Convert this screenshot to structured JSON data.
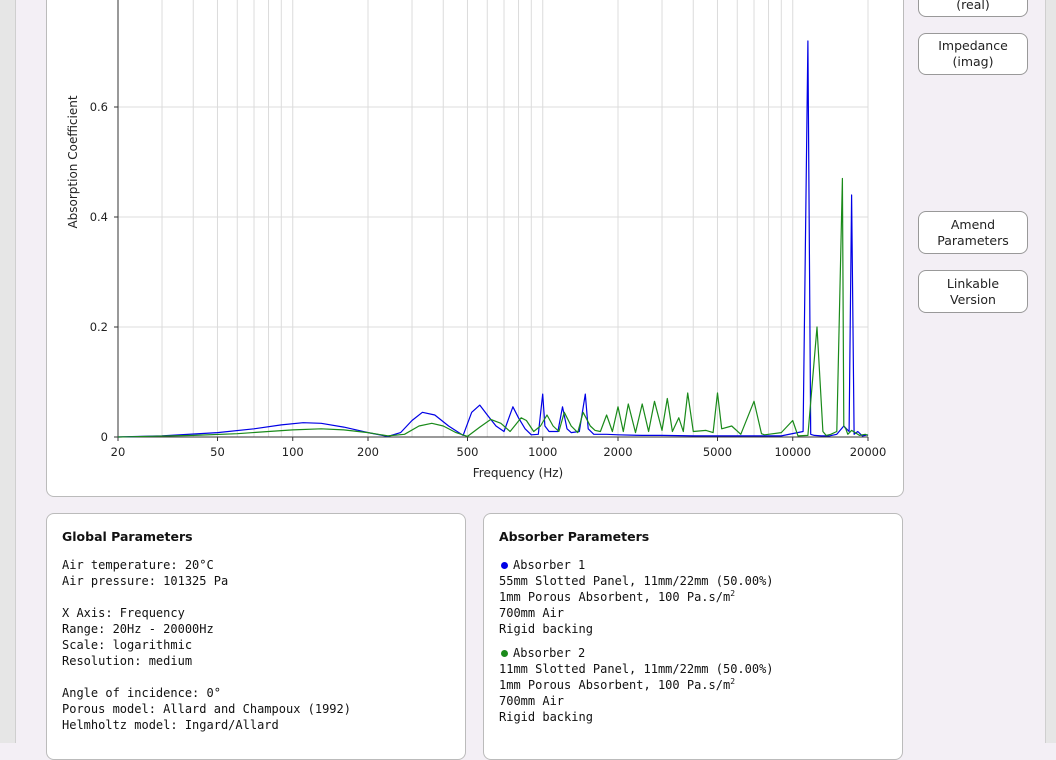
{
  "buttons": {
    "real": "(real)",
    "imag": "Impedance\n(imag)",
    "amend": "Amend\nParameters",
    "link": "Linkable\nVersion"
  },
  "global": {
    "title": "Global Parameters",
    "air_temperature": "Air temperature: 20°C",
    "air_pressure": "Air pressure: 101325 Pa",
    "x_axis": "X Axis: Frequency",
    "range": "Range: 20Hz - 20000Hz",
    "scale": "Scale: logarithmic",
    "resolution": "Resolution: medium",
    "angle": "Angle of incidence: 0°",
    "porous_model": "Porous model: Allard and Champoux (1992)",
    "helmholtz_model": "Helmholtz model: Ingard/Allard"
  },
  "absorbers": {
    "title": "Absorber Parameters",
    "items": [
      {
        "name": "Absorber 1",
        "color": "#0000e6",
        "panel": "55mm Slotted Panel, 11mm/22mm (50.00%)",
        "porous": "1mm Porous Absorbent, 100 Pa.s/m",
        "porous_sup": "2",
        "air": "700mm Air",
        "backing": "Rigid backing"
      },
      {
        "name": "Absorber 2",
        "color": "#1a8a1a",
        "panel": "11mm Slotted Panel, 11mm/22mm (50.00%)",
        "porous": "1mm Porous Absorbent, 100 Pa.s/m",
        "porous_sup": "2",
        "air": "700mm Air",
        "backing": "Rigid backing"
      }
    ]
  },
  "chart_data": {
    "type": "line",
    "xlabel": "Frequency (Hz)",
    "ylabel": "Absorption Coefficient",
    "xscale": "log",
    "xlim": [
      20,
      20000
    ],
    "ylim": [
      0,
      0.75
    ],
    "xticks": [
      20,
      50,
      100,
      200,
      500,
      1000,
      2000,
      5000,
      10000,
      20000
    ],
    "yticks": [
      0,
      0.2,
      0.4,
      0.6
    ],
    "ytick_labels": [
      "0",
      "0.2",
      "0.4",
      "0.6"
    ],
    "grid": true,
    "series": [
      {
        "color": "#0000e6",
        "x": [
          20,
          30,
          50,
          70,
          90,
          110,
          130,
          160,
          200,
          240,
          270,
          300,
          330,
          370,
          420,
          480,
          520,
          560,
          600,
          650,
          700,
          760,
          800,
          850,
          900,
          960,
          1000,
          1020,
          1060,
          1150,
          1200,
          1250,
          1300,
          1400,
          1480,
          1520,
          1600,
          1800,
          2000,
          2500,
          3000,
          4000,
          5000,
          7000,
          9000,
          11000,
          11500,
          11800,
          12200,
          13000,
          14000,
          15000,
          16000,
          16800,
          17200,
          17600,
          18200,
          19000,
          20000
        ],
        "y": [
          0,
          0.002,
          0.008,
          0.015,
          0.022,
          0.026,
          0.025,
          0.018,
          0.008,
          0.001,
          0.008,
          0.03,
          0.045,
          0.04,
          0.02,
          0.003,
          0.045,
          0.058,
          0.04,
          0.02,
          0.01,
          0.055,
          0.035,
          0.015,
          0.004,
          0.005,
          0.078,
          0.02,
          0.01,
          0.01,
          0.055,
          0.015,
          0.008,
          0.01,
          0.078,
          0.015,
          0.005,
          0.005,
          0.004,
          0.003,
          0.003,
          0.002,
          0.002,
          0.002,
          0.002,
          0.01,
          0.72,
          0.005,
          0.003,
          0.002,
          0.002,
          0.005,
          0.02,
          0.01,
          0.44,
          0.005,
          0.01,
          0.002,
          0.004
        ]
      },
      {
        "color": "#1a8a1a",
        "x": [
          20,
          40,
          60,
          80,
          100,
          130,
          160,
          200,
          240,
          280,
          320,
          360,
          400,
          450,
          500,
          560,
          620,
          680,
          740,
          820,
          860,
          920,
          980,
          1040,
          1100,
          1160,
          1220,
          1300,
          1380,
          1450,
          1550,
          1620,
          1700,
          1800,
          1900,
          2000,
          2100,
          2200,
          2350,
          2500,
          2650,
          2800,
          3000,
          3150,
          3300,
          3500,
          3650,
          3800,
          4000,
          4500,
          4800,
          5000,
          5200,
          5700,
          6200,
          7000,
          7500,
          7700,
          8000,
          9000,
          10000,
          10500,
          11500,
          12500,
          13200,
          13600,
          14200,
          15000,
          15800,
          16000,
          16300,
          16600,
          17200,
          18500,
          19500,
          20000
        ],
        "y": [
          0,
          0.003,
          0.006,
          0.01,
          0.013,
          0.015,
          0.013,
          0.008,
          0.002,
          0.005,
          0.02,
          0.025,
          0.02,
          0.008,
          0.001,
          0.018,
          0.032,
          0.025,
          0.01,
          0.035,
          0.03,
          0.01,
          0.02,
          0.04,
          0.02,
          0.01,
          0.045,
          0.02,
          0.008,
          0.045,
          0.02,
          0.012,
          0.01,
          0.04,
          0.01,
          0.055,
          0.01,
          0.06,
          0.008,
          0.06,
          0.01,
          0.065,
          0.012,
          0.07,
          0.01,
          0.035,
          0.01,
          0.08,
          0.01,
          0.012,
          0.008,
          0.08,
          0.015,
          0.02,
          0.005,
          0.065,
          0.006,
          0.004,
          0.005,
          0.008,
          0.03,
          0.002,
          0.003,
          0.2,
          0.01,
          0.003,
          0.005,
          0.01,
          0.47,
          0.02,
          0.015,
          0.005,
          0.012,
          0.003,
          0.005,
          0.003
        ]
      }
    ]
  }
}
